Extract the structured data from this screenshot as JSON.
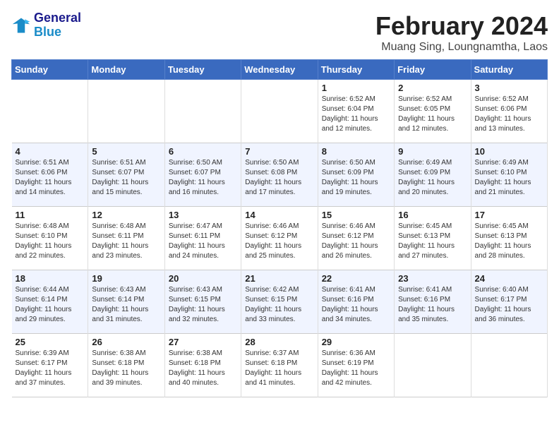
{
  "logo": {
    "line1": "General",
    "line2": "Blue"
  },
  "title": "February 2024",
  "subtitle": "Muang Sing, Loungnamtha, Laos",
  "days_of_week": [
    "Sunday",
    "Monday",
    "Tuesday",
    "Wednesday",
    "Thursday",
    "Friday",
    "Saturday"
  ],
  "weeks": [
    [
      {
        "day": "",
        "info": ""
      },
      {
        "day": "",
        "info": ""
      },
      {
        "day": "",
        "info": ""
      },
      {
        "day": "",
        "info": ""
      },
      {
        "day": "1",
        "info": "Sunrise: 6:52 AM\nSunset: 6:04 PM\nDaylight: 11 hours and 12 minutes."
      },
      {
        "day": "2",
        "info": "Sunrise: 6:52 AM\nSunset: 6:05 PM\nDaylight: 11 hours and 12 minutes."
      },
      {
        "day": "3",
        "info": "Sunrise: 6:52 AM\nSunset: 6:06 PM\nDaylight: 11 hours and 13 minutes."
      }
    ],
    [
      {
        "day": "4",
        "info": "Sunrise: 6:51 AM\nSunset: 6:06 PM\nDaylight: 11 hours and 14 minutes."
      },
      {
        "day": "5",
        "info": "Sunrise: 6:51 AM\nSunset: 6:07 PM\nDaylight: 11 hours and 15 minutes."
      },
      {
        "day": "6",
        "info": "Sunrise: 6:50 AM\nSunset: 6:07 PM\nDaylight: 11 hours and 16 minutes."
      },
      {
        "day": "7",
        "info": "Sunrise: 6:50 AM\nSunset: 6:08 PM\nDaylight: 11 hours and 17 minutes."
      },
      {
        "day": "8",
        "info": "Sunrise: 6:50 AM\nSunset: 6:09 PM\nDaylight: 11 hours and 19 minutes."
      },
      {
        "day": "9",
        "info": "Sunrise: 6:49 AM\nSunset: 6:09 PM\nDaylight: 11 hours and 20 minutes."
      },
      {
        "day": "10",
        "info": "Sunrise: 6:49 AM\nSunset: 6:10 PM\nDaylight: 11 hours and 21 minutes."
      }
    ],
    [
      {
        "day": "11",
        "info": "Sunrise: 6:48 AM\nSunset: 6:10 PM\nDaylight: 11 hours and 22 minutes."
      },
      {
        "day": "12",
        "info": "Sunrise: 6:48 AM\nSunset: 6:11 PM\nDaylight: 11 hours and 23 minutes."
      },
      {
        "day": "13",
        "info": "Sunrise: 6:47 AM\nSunset: 6:11 PM\nDaylight: 11 hours and 24 minutes."
      },
      {
        "day": "14",
        "info": "Sunrise: 6:46 AM\nSunset: 6:12 PM\nDaylight: 11 hours and 25 minutes."
      },
      {
        "day": "15",
        "info": "Sunrise: 6:46 AM\nSunset: 6:12 PM\nDaylight: 11 hours and 26 minutes."
      },
      {
        "day": "16",
        "info": "Sunrise: 6:45 AM\nSunset: 6:13 PM\nDaylight: 11 hours and 27 minutes."
      },
      {
        "day": "17",
        "info": "Sunrise: 6:45 AM\nSunset: 6:13 PM\nDaylight: 11 hours and 28 minutes."
      }
    ],
    [
      {
        "day": "18",
        "info": "Sunrise: 6:44 AM\nSunset: 6:14 PM\nDaylight: 11 hours and 29 minutes."
      },
      {
        "day": "19",
        "info": "Sunrise: 6:43 AM\nSunset: 6:14 PM\nDaylight: 11 hours and 31 minutes."
      },
      {
        "day": "20",
        "info": "Sunrise: 6:43 AM\nSunset: 6:15 PM\nDaylight: 11 hours and 32 minutes."
      },
      {
        "day": "21",
        "info": "Sunrise: 6:42 AM\nSunset: 6:15 PM\nDaylight: 11 hours and 33 minutes."
      },
      {
        "day": "22",
        "info": "Sunrise: 6:41 AM\nSunset: 6:16 PM\nDaylight: 11 hours and 34 minutes."
      },
      {
        "day": "23",
        "info": "Sunrise: 6:41 AM\nSunset: 6:16 PM\nDaylight: 11 hours and 35 minutes."
      },
      {
        "day": "24",
        "info": "Sunrise: 6:40 AM\nSunset: 6:17 PM\nDaylight: 11 hours and 36 minutes."
      }
    ],
    [
      {
        "day": "25",
        "info": "Sunrise: 6:39 AM\nSunset: 6:17 PM\nDaylight: 11 hours and 37 minutes."
      },
      {
        "day": "26",
        "info": "Sunrise: 6:38 AM\nSunset: 6:18 PM\nDaylight: 11 hours and 39 minutes."
      },
      {
        "day": "27",
        "info": "Sunrise: 6:38 AM\nSunset: 6:18 PM\nDaylight: 11 hours and 40 minutes."
      },
      {
        "day": "28",
        "info": "Sunrise: 6:37 AM\nSunset: 6:18 PM\nDaylight: 11 hours and 41 minutes."
      },
      {
        "day": "29",
        "info": "Sunrise: 6:36 AM\nSunset: 6:19 PM\nDaylight: 11 hours and 42 minutes."
      },
      {
        "day": "",
        "info": ""
      },
      {
        "day": "",
        "info": ""
      }
    ]
  ]
}
